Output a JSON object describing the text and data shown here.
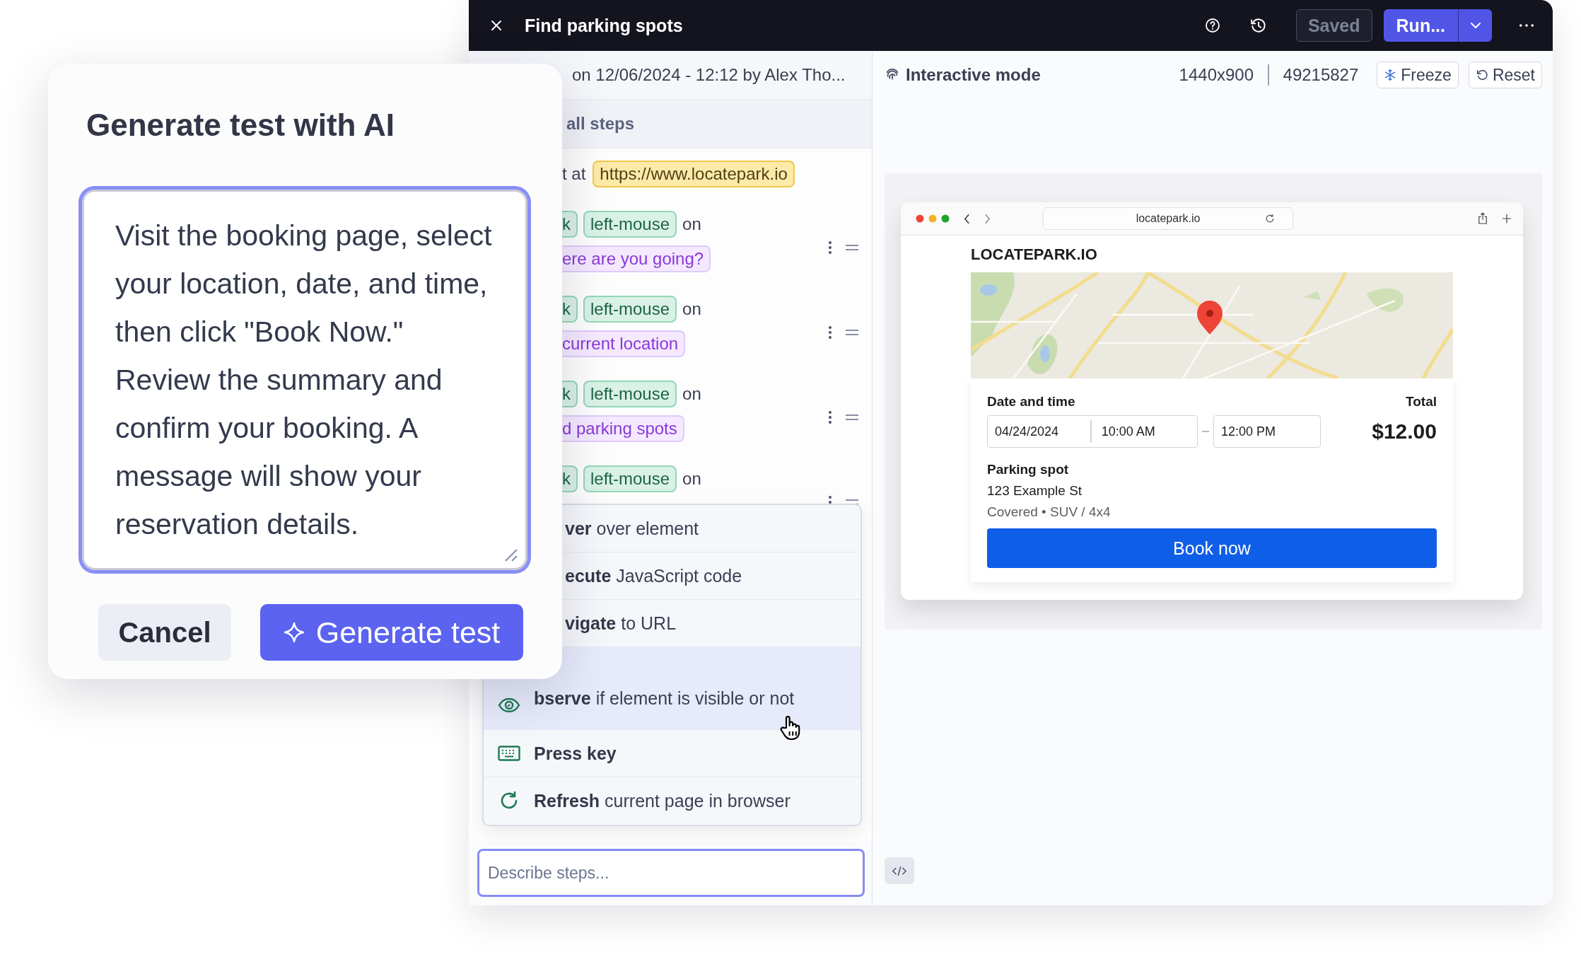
{
  "window": {
    "title": "Find parking spots",
    "saved": {
      "label": "Saved",
      "disabled": true
    },
    "run": {
      "label": "Run..."
    }
  },
  "editor": {
    "history": "on 12/06/2024 - 12:12 by Alex Tho...",
    "steps_header": "all steps",
    "start": {
      "text": "t at",
      "url": "https://www.locatepark.io"
    },
    "steps": [
      {
        "action": "k",
        "button": "left-mouse",
        "joiner": "on",
        "target": "ere are you going?"
      },
      {
        "action": "k",
        "button": "left-mouse",
        "joiner": "on",
        "target": "current location"
      },
      {
        "action": "k",
        "button": "left-mouse",
        "joiner": "on",
        "target": "d parking spots"
      },
      {
        "action": "k",
        "button": "left-mouse",
        "joiner": "on"
      }
    ],
    "menu": [
      {
        "kind": "hover",
        "action": "ver",
        "detail": "over element",
        "selected": false
      },
      {
        "kind": "script",
        "action": "ecute",
        "detail": "JavaScript code",
        "selected": false
      },
      {
        "kind": "navigate",
        "action": "vigate",
        "detail": "to URL",
        "selected": false
      },
      {
        "kind": "observe",
        "action": "bserve",
        "detail": "if element is visible or not",
        "selected": true
      },
      {
        "kind": "keyboard",
        "action": "Press key",
        "selected": false
      },
      {
        "kind": "refresh",
        "action": "Refresh",
        "detail": "current page in browser",
        "selected": false
      }
    ],
    "input": {
      "placeholder": "Describe steps..."
    }
  },
  "preview": {
    "mode": "Interactive mode",
    "viewport": "1440x900",
    "identifier": "49215827",
    "freeze": "Freeze",
    "reset": "Reset",
    "browser": {
      "address": "locatepark.io",
      "site_title": "LOCATEPARK.IO",
      "date_label": "Date and time",
      "date": "04/24/2024",
      "start_time": "10:00 AM",
      "end_time": "12:00 PM",
      "total_label": "Total",
      "total": "$12.00",
      "spot_label": "Parking spot",
      "street": "123 Example St",
      "details": "Covered • SUV / 4x4",
      "book": "Book now"
    }
  },
  "dialog": {
    "title": "Generate test with AI",
    "prompt": "Visit the booking page, select your location, date, and time, then click \"Book Now.\" Review the summary and confirm your booking. A message will show your reservation details.",
    "buttons": [
      {
        "label": "Cancel",
        "kind": "secondary"
      },
      {
        "label": "Generate test",
        "kind": "primary"
      }
    ]
  }
}
